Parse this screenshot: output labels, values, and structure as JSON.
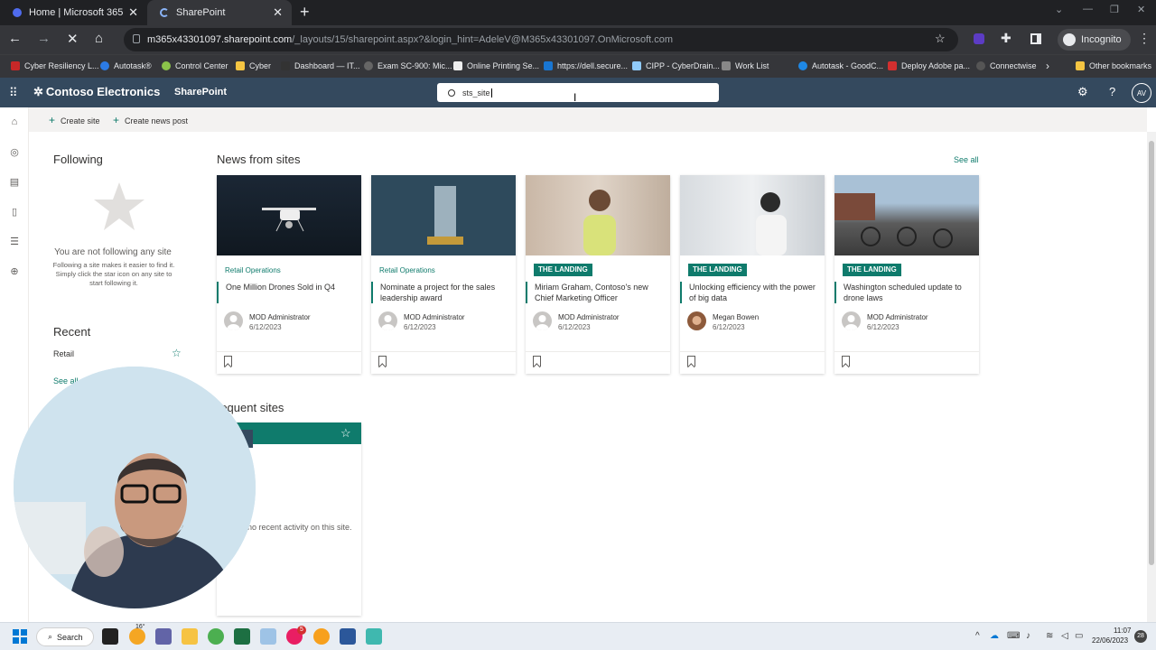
{
  "browser": {
    "tabs": [
      {
        "title": "Home | Microsoft 365"
      },
      {
        "title": "SharePoint"
      }
    ],
    "url_host": "m365x43301097.sharepoint.com",
    "url_path": "/_layouts/15/sharepoint.aspx?&login_hint=AdeleV@M365x43301097.OnMicrosoft.com",
    "incognito_label": "Incognito",
    "bookmarks": [
      "Cyber Resiliency L...",
      "Autotask®",
      "Control Center",
      "Cyber",
      "Dashboard — IT...",
      "Exam SC-900: Mic...",
      "Online Printing Se...",
      "https://dell.secure...",
      "CIPP - CyberDrain...",
      "Work List",
      "Autotask - GoodC...",
      "Deploy Adobe pa...",
      "Connectwise"
    ],
    "other_bookmarks": "Other bookmarks"
  },
  "suite": {
    "brand": "Contoso Electronics",
    "app": "SharePoint",
    "search_value": "sts_site",
    "avatar_initials": "AV"
  },
  "commands": {
    "create_site": "Create site",
    "create_news": "Create news post"
  },
  "following": {
    "title": "Following",
    "empty_title": "You are not following any site",
    "empty_desc": "Following a site makes it easier to find it. Simply click the star icon on any site to start following it."
  },
  "recent": {
    "title": "Recent",
    "items": [
      "Retail"
    ],
    "see_all": "See all"
  },
  "news": {
    "title": "News from sites",
    "see_all": "See all",
    "cards": [
      {
        "site": "Retail Operations",
        "badge": "",
        "title": "One Million Drones Sold in Q4",
        "author": "MOD Administrator",
        "date": "6/12/2023"
      },
      {
        "site": "Retail Operations",
        "badge": "",
        "title": "Nominate a project for the sales leadership award",
        "author": "MOD Administrator",
        "date": "6/12/2023"
      },
      {
        "site": "",
        "badge": "THE LANDING",
        "title": "Miriam Graham, Contoso's new Chief Marketing Officer",
        "author": "MOD Administrator",
        "date": "6/12/2023"
      },
      {
        "site": "",
        "badge": "THE LANDING",
        "title": "Unlocking efficiency with the power of big data",
        "author": "Megan Bowen",
        "date": "6/12/2023"
      },
      {
        "site": "",
        "badge": "THE LANDING",
        "title": "Washington scheduled update to drone laws",
        "author": "MOD Administrator",
        "date": "6/12/2023"
      }
    ]
  },
  "frequent": {
    "title": "Frequent sites",
    "title_visible": "requent sites",
    "activity": "no recent activity on this site."
  },
  "taskbar": {
    "search_label": "Search",
    "weather": "16°",
    "mail_badge": "5",
    "time": "11:07",
    "date": "22/06/2023",
    "notif": "28"
  },
  "colors": {
    "suite_bar": "#34495e",
    "accent": "#0f7b6c",
    "chrome_dark": "#202124"
  }
}
